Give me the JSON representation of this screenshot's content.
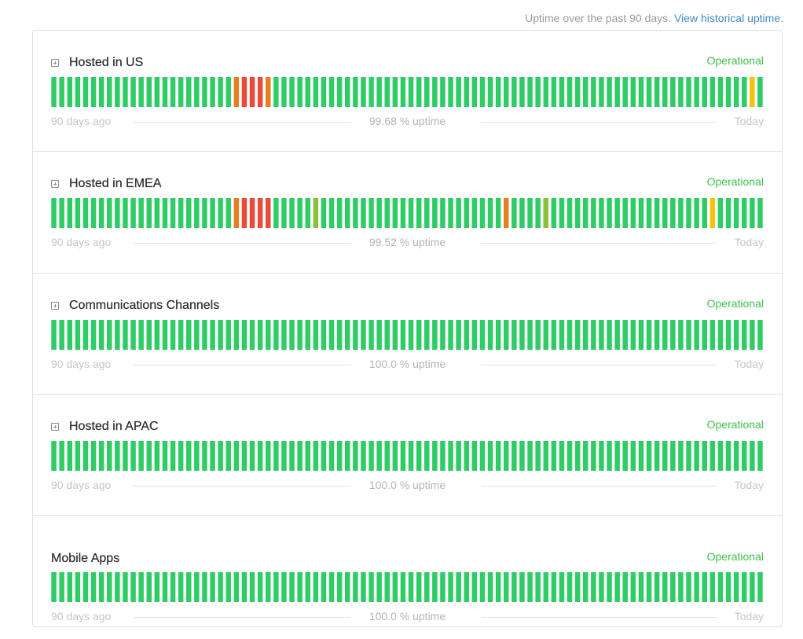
{
  "header": {
    "note_text": "Uptime over the past 90 days.",
    "link_text": "View historical uptime."
  },
  "legend": {
    "left": "90 days ago",
    "right": "Today"
  },
  "colors": {
    "operational": "#3cbf4b",
    "bar_ok": "#2fcc66",
    "bar_major": "#e74c3c",
    "bar_partial": "#e67e22",
    "bar_minor": "#f1c40f",
    "bar_degraded": "#8ebf3b"
  },
  "components": [
    {
      "name": "Hosted in US",
      "expandable": true,
      "status": "Operational",
      "uptime_text": "99.68 % uptime",
      "days": [
        "ok",
        "ok",
        "ok",
        "ok",
        "ok",
        "ok",
        "ok",
        "ok",
        "ok",
        "ok",
        "ok",
        "ok",
        "ok",
        "ok",
        "ok",
        "ok",
        "ok",
        "ok",
        "ok",
        "ok",
        "ok",
        "ok",
        "ok",
        "partial",
        "major",
        "major",
        "major",
        "partial",
        "ok",
        "ok",
        "ok",
        "ok",
        "ok",
        "ok",
        "ok",
        "ok",
        "ok",
        "ok",
        "ok",
        "ok",
        "ok",
        "ok",
        "ok",
        "ok",
        "ok",
        "ok",
        "ok",
        "ok",
        "ok",
        "ok",
        "ok",
        "ok",
        "ok",
        "ok",
        "ok",
        "ok",
        "ok",
        "ok",
        "ok",
        "ok",
        "ok",
        "ok",
        "ok",
        "ok",
        "ok",
        "ok",
        "ok",
        "ok",
        "ok",
        "ok",
        "ok",
        "ok",
        "ok",
        "ok",
        "ok",
        "ok",
        "ok",
        "ok",
        "ok",
        "ok",
        "ok",
        "ok",
        "ok",
        "ok",
        "ok",
        "ok",
        "ok",
        "ok",
        "minor",
        "ok"
      ]
    },
    {
      "name": "Hosted in EMEA",
      "expandable": true,
      "status": "Operational",
      "uptime_text": "99.52 % uptime",
      "days": [
        "ok",
        "ok",
        "ok",
        "ok",
        "ok",
        "ok",
        "ok",
        "ok",
        "ok",
        "ok",
        "ok",
        "ok",
        "ok",
        "ok",
        "ok",
        "ok",
        "ok",
        "ok",
        "ok",
        "ok",
        "ok",
        "ok",
        "ok",
        "partial",
        "major",
        "major",
        "major",
        "major",
        "ok",
        "ok",
        "ok",
        "ok",
        "ok",
        "degraded",
        "ok",
        "ok",
        "ok",
        "ok",
        "ok",
        "ok",
        "ok",
        "ok",
        "ok",
        "ok",
        "ok",
        "ok",
        "ok",
        "ok",
        "ok",
        "ok",
        "ok",
        "ok",
        "ok",
        "ok",
        "ok",
        "ok",
        "ok",
        "partial",
        "ok",
        "ok",
        "ok",
        "ok",
        "degraded",
        "ok",
        "ok",
        "ok",
        "ok",
        "ok",
        "ok",
        "ok",
        "ok",
        "ok",
        "ok",
        "ok",
        "ok",
        "ok",
        "ok",
        "ok",
        "ok",
        "ok",
        "ok",
        "ok",
        "ok",
        "minor",
        "ok",
        "ok",
        "ok",
        "ok",
        "ok",
        "ok"
      ]
    },
    {
      "name": "Communications Channels",
      "expandable": true,
      "status": "Operational",
      "uptime_text": "100.0 % uptime",
      "days": []
    },
    {
      "name": "Hosted in APAC",
      "expandable": true,
      "status": "Operational",
      "uptime_text": "100.0 % uptime",
      "days": []
    },
    {
      "name": "Mobile Apps",
      "expandable": false,
      "status": "Operational",
      "uptime_text": "100.0 % uptime",
      "days": []
    }
  ]
}
